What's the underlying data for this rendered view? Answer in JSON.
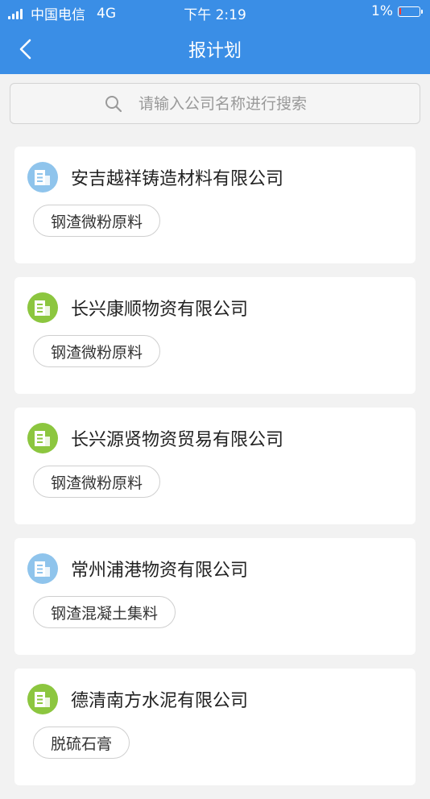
{
  "status_bar": {
    "carrier": "中国电信",
    "network": "4G",
    "time": "下午 2:19",
    "battery": "1%"
  },
  "nav": {
    "title": "报计划",
    "back_icon": "chevron-left-icon"
  },
  "search": {
    "placeholder": "请输入公司名称进行搜索",
    "value": "",
    "icon": "search-icon"
  },
  "colors": {
    "primary": "#3a8ee6",
    "icon_blue": "#8fc4ec",
    "icon_green": "#8cc63f",
    "background": "#f2f2f2"
  },
  "companies": [
    {
      "name": "安吉越祥铸造材料有限公司",
      "tag": "钢渣微粉原料",
      "icon_color": "blue"
    },
    {
      "name": "长兴康顺物资有限公司",
      "tag": "钢渣微粉原料",
      "icon_color": "green"
    },
    {
      "name": "长兴源贤物资贸易有限公司",
      "tag": "钢渣微粉原料",
      "icon_color": "green"
    },
    {
      "name": "常州浦港物资有限公司",
      "tag": "钢渣混凝土集料",
      "icon_color": "blue"
    },
    {
      "name": "德清南方水泥有限公司",
      "tag": "脱硫石膏",
      "icon_color": "green"
    }
  ]
}
